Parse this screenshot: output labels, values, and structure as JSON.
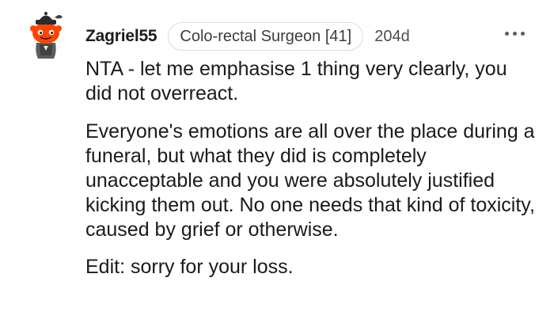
{
  "comment": {
    "username": "Zagriel55",
    "flair": "Colo-rectal Surgeon [41]",
    "age": "204d",
    "avatar_icon": "reddit-snoo-avatar-icon",
    "more_icon": "more-horizontal-icon",
    "paragraphs": [
      "NTA - let me emphasise 1 thing very clearly, you did not overreact.",
      "Everyone's emotions are all over the place during a funeral, but what they did is completely unacceptable and you were absolutely justified kicking them out. No one needs that kind of toxicity, caused by grief or otherwise.",
      "Edit: sorry for your loss."
    ]
  },
  "colors": {
    "avatar_orange": "#ff4500",
    "text": "#1a1a1b",
    "flair_border": "#d9dcdf",
    "meta": "#4a4d50"
  }
}
